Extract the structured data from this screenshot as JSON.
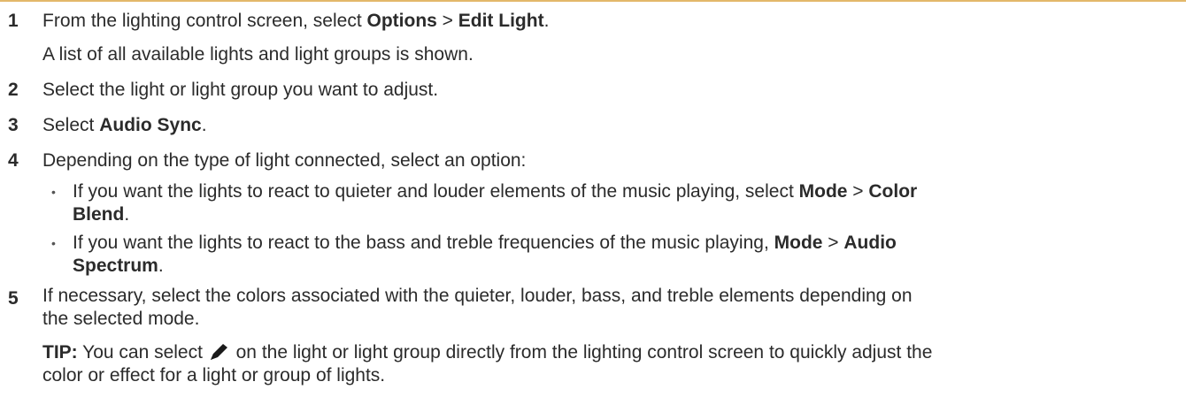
{
  "steps": [
    {
      "number": "1",
      "parts": [
        "From the lighting control screen, select ",
        "Options",
        " > ",
        "Edit Light",
        "."
      ],
      "note": "A list of all available lights and light groups is shown."
    },
    {
      "number": "2",
      "text": "Select the light or light group you want to adjust."
    },
    {
      "number": "3",
      "parts": [
        "Select ",
        "Audio Sync",
        "."
      ]
    },
    {
      "number": "4",
      "text": "Depending on the type of light connected, select an option:",
      "bullets": [
        {
          "parts": [
            "If you want the lights to react to quieter and louder elements of the music playing, select ",
            "Mode",
            " > ",
            "Color",
            "Blend",
            "."
          ]
        },
        {
          "parts": [
            "If you want the lights to react to the bass and treble frequencies of the music playing, ",
            "Mode",
            " > ",
            "Audio",
            "Spectrum",
            "."
          ]
        }
      ]
    },
    {
      "number": "5",
      "line1": "If necessary, select the colors associated with the quieter, louder, bass, and treble elements depending on",
      "line2": "the selected mode.",
      "tip": {
        "label": "TIP:",
        "before_icon": " You can select ",
        "icon": "pencil-icon",
        "after_icon_line1": " on the light or light group directly from the lighting control screen to quickly adjust the",
        "line2": "color or effect for a light or group of lights."
      }
    }
  ],
  "colors": {
    "text": "#2b2b2b",
    "top_rule": "#e3b86a"
  }
}
